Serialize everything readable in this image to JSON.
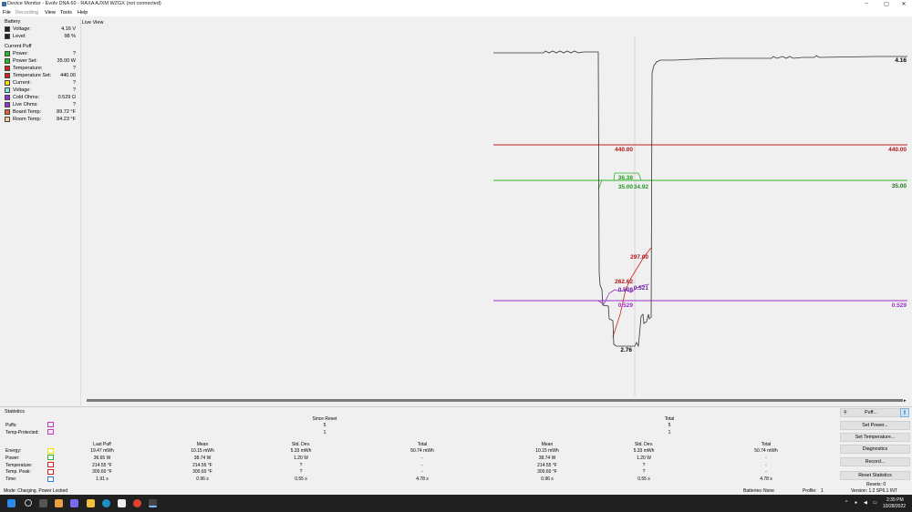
{
  "window": {
    "title": "Device Monitor - Evolv DNA 60 - RAXA AJXM WZGX (not connected)",
    "minimize": "–",
    "maximize": "▢",
    "close": "✕"
  },
  "menu": [
    "File",
    "Recording",
    "View",
    "Tools",
    "Help"
  ],
  "battery": {
    "section": "Battery",
    "rows": [
      {
        "label": "Voltage:",
        "value": "4.16 V",
        "color": "#222222"
      },
      {
        "label": "Level:",
        "value": "98 %",
        "color": "#222222"
      }
    ]
  },
  "current_puff": {
    "section": "Current Puff",
    "rows": [
      {
        "label": "Power:",
        "value": "?",
        "color": "#2db52d"
      },
      {
        "label": "Power Set:",
        "value": "35.00 W",
        "color": "#2db52d"
      },
      {
        "label": "Temperature:",
        "value": "?",
        "color": "#d12020"
      },
      {
        "label": "Temperature Set:",
        "value": "440.00",
        "color": "#d12020"
      },
      {
        "label": "Current:",
        "value": "?",
        "color": "#f5e000"
      },
      {
        "label": "Voltage:",
        "value": "?",
        "color": "#7fe8d8"
      },
      {
        "label": "Cold Ohms:",
        "value": "0.529 Ω",
        "color": "#9933cc"
      },
      {
        "label": "Live Ohms:",
        "value": "?",
        "color": "#9933cc"
      },
      {
        "label": "Board Temp:",
        "value": "89.72 °F",
        "color": "#e0603a"
      },
      {
        "label": "Room Temp:",
        "value": "84.23 °F",
        "color": "#f5c9a0"
      }
    ]
  },
  "live_view": {
    "title": "Live View",
    "labels": {
      "voltage_end": "4.16",
      "temp_set_mid": "440.00",
      "temp_set_end": "440.00",
      "power_top": "36.38",
      "power_set": "35.00",
      "power_live": "34.92",
      "power_set_end": "35.00",
      "temp_peak": "297.00",
      "temp_mid": "262.62",
      "ohms_live": "0.508",
      "ohms_live2": "0.521",
      "ohms_cold": "0.529",
      "ohms_cold_end": "0.529",
      "voltage_min": "2.76"
    }
  },
  "statistics": {
    "title": "Statistics",
    "since_reset": "Since Reset",
    "total": "Total",
    "puffs_label": "Puffs:",
    "temp_protected_label": "Temp-Protected:",
    "puffs_since": "5",
    "temp_since": "1",
    "puffs_total": "5",
    "temp_total": "1",
    "col_headers": [
      "Last Puff",
      "Mean",
      "Std. Dev.",
      "Total",
      "Mean",
      "Std. Dev.",
      "Total"
    ],
    "rows": [
      {
        "label": "Energy:",
        "color": "#f5e000",
        "values": [
          "19.47 mWh",
          "10.15 mWh",
          "5.33 mWh",
          "50.74 mWh",
          "10.15 mWh",
          "5.33 mWh",
          "50.74 mWh"
        ]
      },
      {
        "label": "Power:",
        "color": "#2db52d",
        "values": [
          "36.65 W",
          "38.74 W",
          "1.20 W",
          "-",
          "38.74 W",
          "1.20 W",
          "-"
        ]
      },
      {
        "label": "Temperature:",
        "color": "#d12020",
        "values": [
          "214.55 °F",
          "214.55 °F",
          "?",
          "-",
          "214.55 °F",
          "?",
          "-"
        ]
      },
      {
        "label": "Temp. Peak:",
        "color": "#d12020",
        "values": [
          "300.60 °F",
          "300.60 °F",
          "?",
          "-",
          "300.60 °F",
          "?",
          "-"
        ]
      },
      {
        "label": "Time:",
        "color": "#2e7fd6",
        "values": [
          "1.91 s",
          "0.96 s",
          "0.55 s",
          "4.78 s",
          "0.96 s",
          "0.55 s",
          "4.78 s"
        ]
      }
    ]
  },
  "buttons": {
    "puff": "Puff...",
    "set_power": "Set Power...",
    "set_temperature": "Set Temperature...",
    "diagnostics": "Diagnostics",
    "record": "Record...",
    "reset_statistics": "Reset Statistics"
  },
  "status": {
    "mode": "Mode: Charging, Power Locked",
    "batteries": "Batteries:",
    "batteries_val": "None",
    "profile": "Profile:",
    "profile_val": "1",
    "resets": "Resets: 0",
    "version": "Version: 1.2 SP6.1 INT"
  },
  "taskbar": {
    "time": "2:35 PM",
    "date": "10/28/2022"
  }
}
